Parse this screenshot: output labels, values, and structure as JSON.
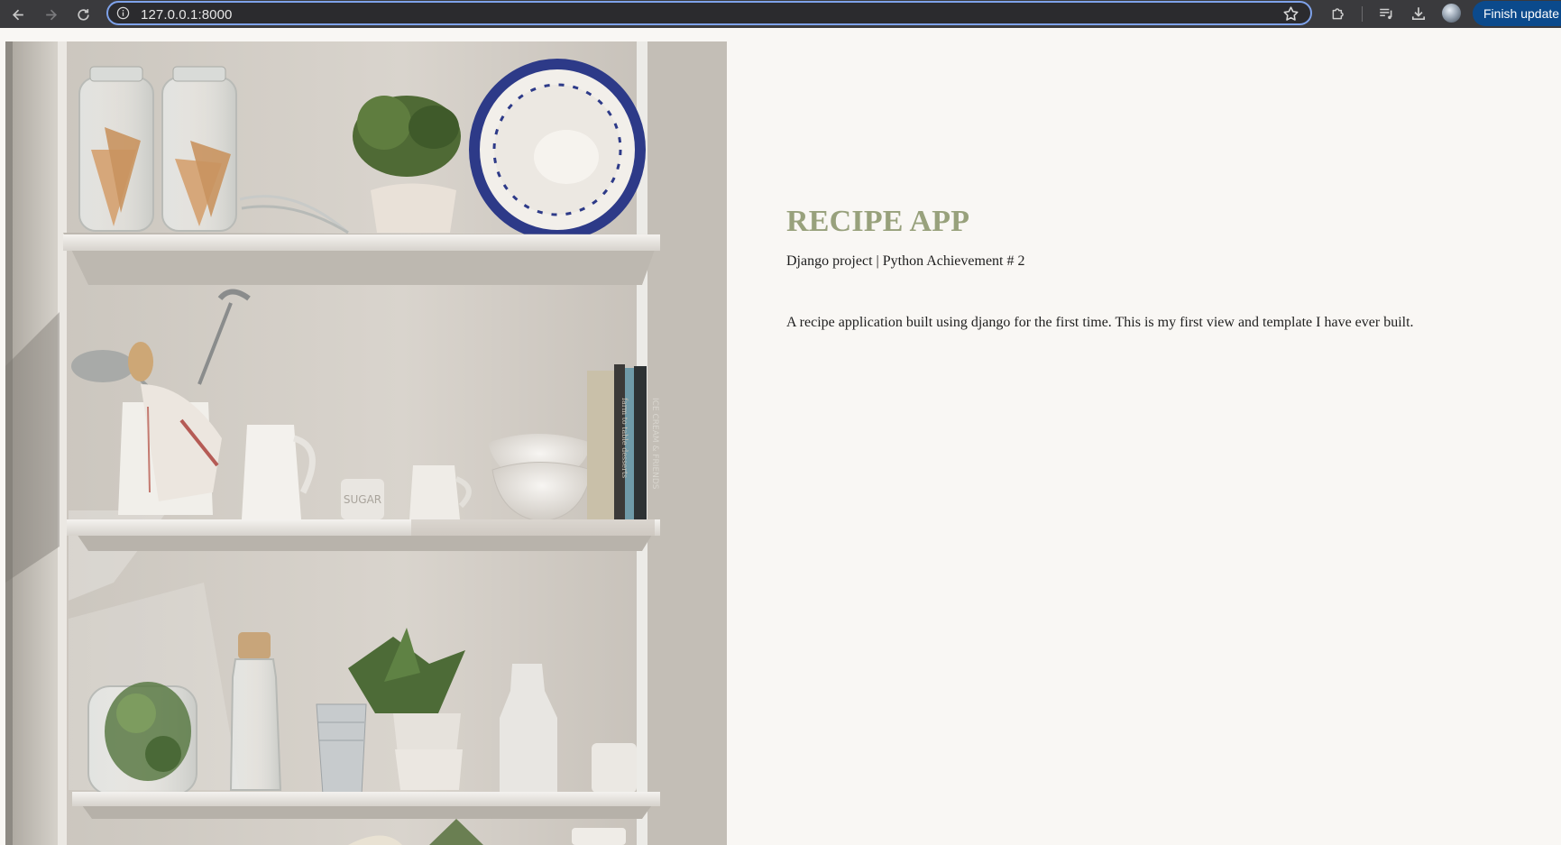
{
  "browser": {
    "url": "127.0.0.1:8000",
    "finish_update_label": "Finish update",
    "accent_color": "#7ea2ea",
    "update_button_color": "#0b4a8c"
  },
  "page": {
    "title": "RECIPE APP",
    "subtitle": "Django project | Python Achievement # 2",
    "description": "A recipe application built using django for the first time. This is my first view and template I have ever built.",
    "title_color": "#98a17c",
    "background_color": "#f9f7f4"
  },
  "hero_image": {
    "subject": "kitchen shelves with jars, plants, bowls and books",
    "book_titles": [
      "ICE CREAM & FRIENDS",
      "farm to table desserts"
    ],
    "jar_label": "SUGAR"
  }
}
